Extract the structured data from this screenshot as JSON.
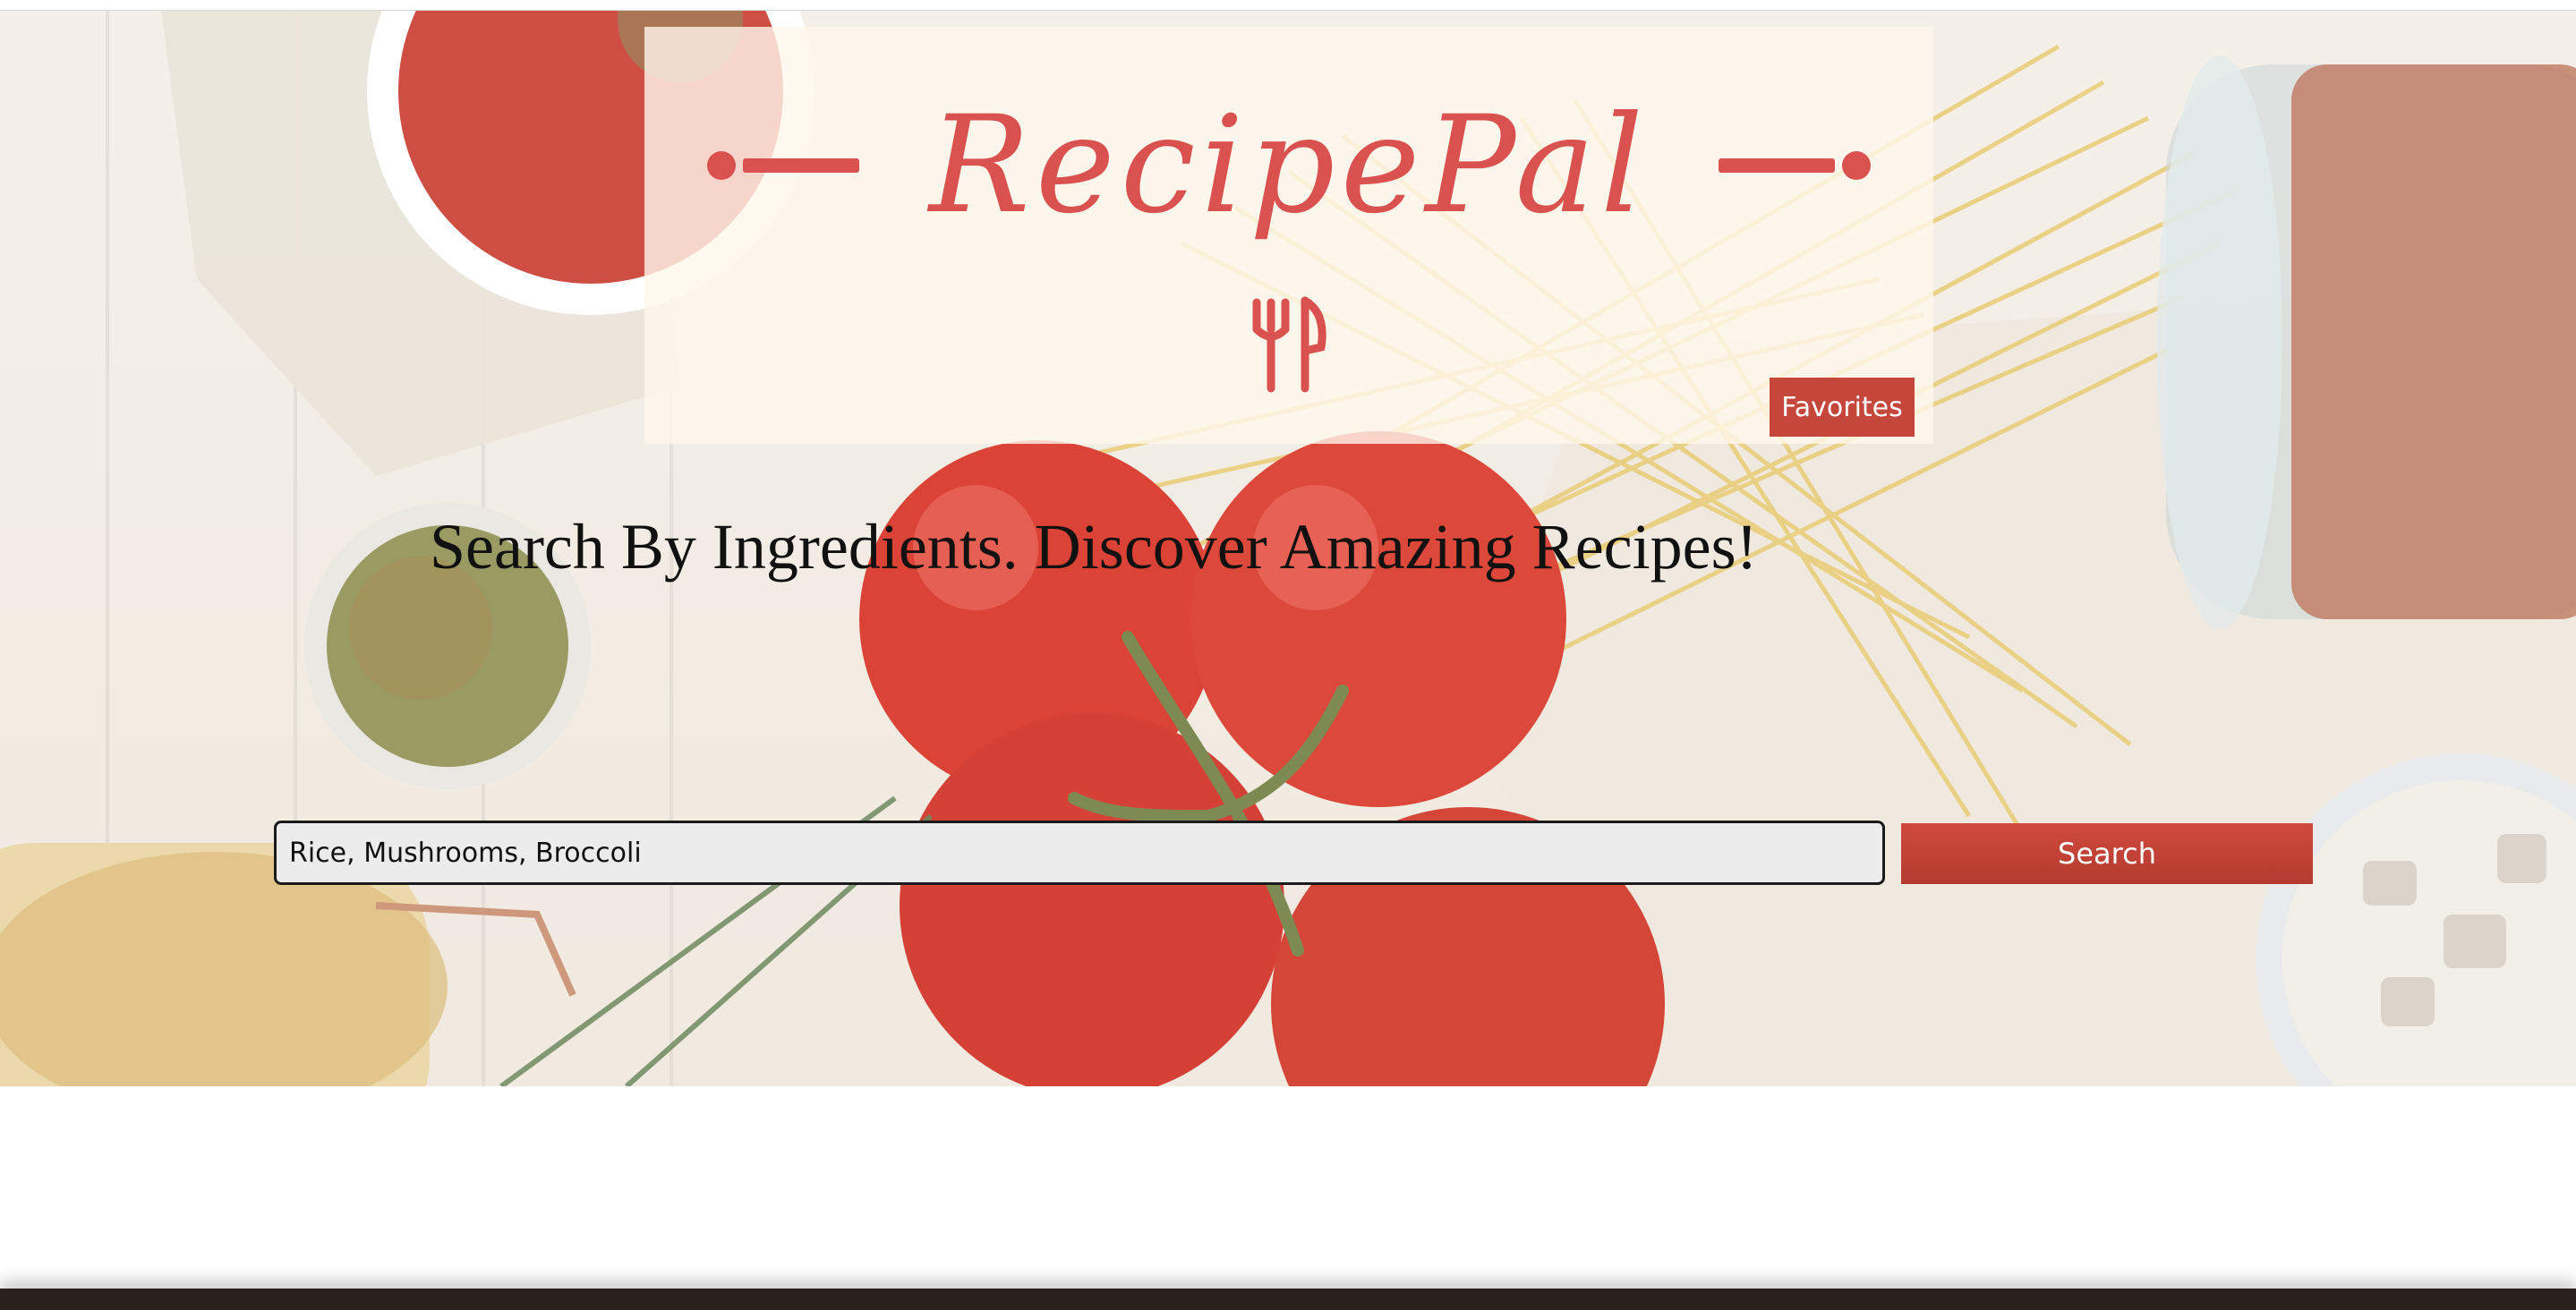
{
  "header": {
    "logo_text": "RecipePal",
    "logo_icon": "fork-and-knife-icon",
    "favorites_label": "Favorites"
  },
  "hero": {
    "tagline": "Search By Ingredients. Discover Amazing Recipes!",
    "background": "food-ingredients-photo"
  },
  "search": {
    "value": "Rice, Mushrooms, Broccoli",
    "button_label": "Search"
  },
  "colors": {
    "brand": "#d9524f",
    "button": "#c5463b",
    "footer": "#2a211a"
  }
}
